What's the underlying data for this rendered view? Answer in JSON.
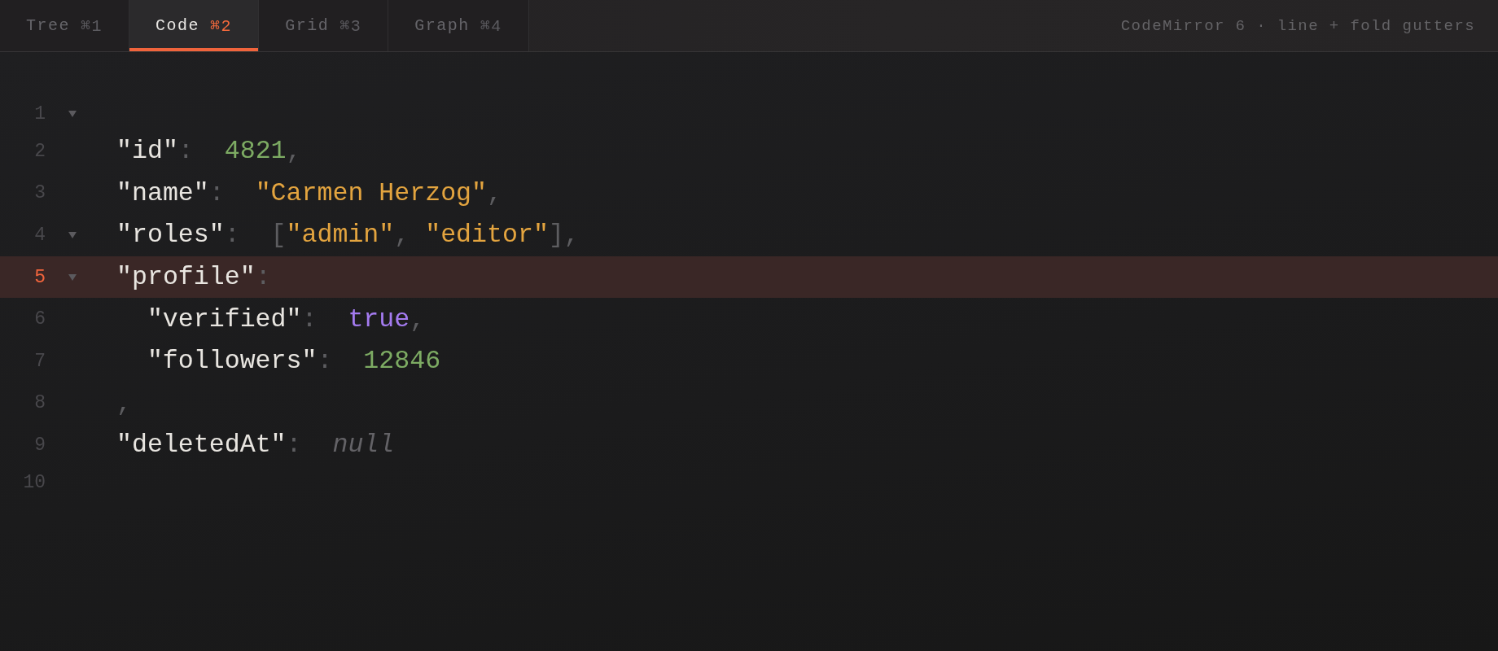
{
  "tabs": [
    {
      "label": "Tree",
      "shortcut": "⌘1",
      "selected": false
    },
    {
      "label": "Code",
      "shortcut": "⌘2",
      "selected": true
    },
    {
      "label": "Grid",
      "shortcut": "⌘3",
      "selected": false
    },
    {
      "label": "Graph",
      "shortcut": "⌘4",
      "selected": false
    }
  ],
  "info": "CodeMirror 6 · line + fold gutters",
  "editor": {
    "lines": [
      {
        "number": "1",
        "foldable": true,
        "active": false
      },
      {
        "number": "2",
        "foldable": false,
        "active": false,
        "tokens": [
          {
            "kind": "key",
            "text": "\"id\""
          },
          {
            "kind": "colon",
            "text": ":"
          },
          {
            "kind": "number",
            "text": "4821"
          },
          {
            "kind": "comma",
            "text": ","
          }
        ]
      },
      {
        "number": "3",
        "foldable": false,
        "active": false,
        "tokens": [
          {
            "kind": "key",
            "text": "\"name\""
          },
          {
            "kind": "colon",
            "text": ":"
          },
          {
            "kind": "string",
            "text": "\"Carmen Herzog\""
          },
          {
            "kind": "comma",
            "text": ","
          }
        ]
      },
      {
        "number": "4",
        "foldable": true,
        "active": false,
        "tokens": [
          {
            "kind": "key",
            "text": "\"roles\""
          },
          {
            "kind": "colon",
            "text": ":"
          },
          {
            "kind": "bracket",
            "text": "["
          },
          {
            "kind": "string",
            "text": "\"admin\""
          },
          {
            "kind": "comma",
            "text": ","
          },
          {
            "kind": "string",
            "text": "\"editor\""
          },
          {
            "kind": "bracket",
            "text": "]"
          },
          {
            "kind": "comma",
            "text": ","
          }
        ]
      },
      {
        "number": "5",
        "foldable": true,
        "active": true,
        "tokens": [
          {
            "kind": "key",
            "text": "\"profile\""
          },
          {
            "kind": "colon",
            "text": ":"
          }
        ],
        "children": [
          {
            "number": "6",
            "foldable": false,
            "active": false,
            "tokens": [
              {
                "kind": "key",
                "text": "\"verified\""
              },
              {
                "kind": "colon",
                "text": ":"
              },
              {
                "kind": "boolean",
                "text": "true"
              },
              {
                "kind": "comma",
                "text": ","
              }
            ]
          },
          {
            "number": "7",
            "foldable": false,
            "active": false,
            "tokens": [
              {
                "kind": "key",
                "text": "\"followers\""
              },
              {
                "kind": "colon",
                "text": ":"
              },
              {
                "kind": "number",
                "text": "12846"
              }
            ]
          }
        ]
      },
      {
        "number": "8",
        "foldable": false,
        "active": false,
        "tokens": [
          {
            "kind": "comma",
            "text": ","
          }
        ]
      },
      {
        "number": "9",
        "foldable": false,
        "active": false,
        "tokens": [
          {
            "kind": "key",
            "text": "\"deletedAt\""
          },
          {
            "kind": "colon",
            "text": ":"
          },
          {
            "kind": "null",
            "text": "null"
          }
        ]
      },
      {
        "number": "10",
        "foldable": false,
        "active": false
      }
    ]
  }
}
